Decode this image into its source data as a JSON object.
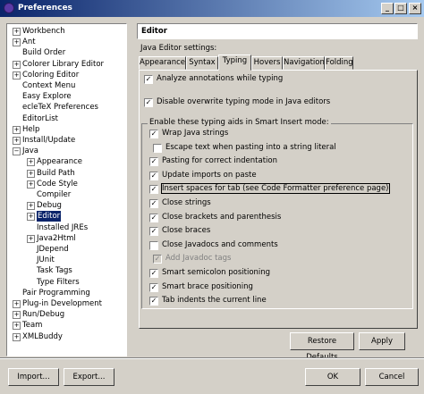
{
  "window": {
    "title": "Preferences",
    "controls": {
      "minimize": "_",
      "maximize": "□",
      "close": "×"
    }
  },
  "tree": {
    "items": [
      {
        "label": "Workbench",
        "toggle": "+"
      },
      {
        "label": "Ant",
        "toggle": "+"
      },
      {
        "label": "Build Order",
        "toggle": ""
      },
      {
        "label": "Colorer Library Editor",
        "toggle": "+"
      },
      {
        "label": "Coloring Editor",
        "toggle": "+"
      },
      {
        "label": "Context Menu",
        "toggle": ""
      },
      {
        "label": "Easy Explore",
        "toggle": ""
      },
      {
        "label": "ecleTeX Preferences",
        "toggle": ""
      },
      {
        "label": "EditorList",
        "toggle": ""
      },
      {
        "label": "Help",
        "toggle": "+"
      },
      {
        "label": "Install/Update",
        "toggle": "+"
      },
      {
        "label": "Java",
        "toggle": "−"
      },
      {
        "label": "Appearance",
        "toggle": "+"
      },
      {
        "label": "Build Path",
        "toggle": "+"
      },
      {
        "label": "Code Style",
        "toggle": "+"
      },
      {
        "label": "Compiler",
        "toggle": ""
      },
      {
        "label": "Debug",
        "toggle": "+"
      },
      {
        "label": "Editor",
        "toggle": "+",
        "selected": true
      },
      {
        "label": "Installed JREs",
        "toggle": ""
      },
      {
        "label": "Java2Html",
        "toggle": "+"
      },
      {
        "label": "JDepend",
        "toggle": ""
      },
      {
        "label": "JUnit",
        "toggle": ""
      },
      {
        "label": "Task Tags",
        "toggle": ""
      },
      {
        "label": "Type Filters",
        "toggle": ""
      },
      {
        "label": "Pair Programming",
        "toggle": ""
      },
      {
        "label": "Plug-in Development",
        "toggle": "+"
      },
      {
        "label": "Run/Debug",
        "toggle": "+"
      },
      {
        "label": "Team",
        "toggle": "+"
      },
      {
        "label": "XMLBuddy",
        "toggle": "+"
      }
    ]
  },
  "page": {
    "title": "Editor",
    "subtitle": "Java Editor settings:"
  },
  "tabs": [
    {
      "label": "Appearance"
    },
    {
      "label": "Syntax"
    },
    {
      "label": "Typing",
      "active": true
    },
    {
      "label": "Hovers"
    },
    {
      "label": "Navigation"
    },
    {
      "label": "Folding"
    }
  ],
  "typing": {
    "top_options": [
      {
        "label": "Analyze annotations while typing",
        "checked": true
      },
      {
        "label": "Disable overwrite typing mode in Java editors",
        "checked": true
      }
    ],
    "group_label": "Enable these typing aids in Smart Insert mode:",
    "group_options": [
      {
        "label": "Wrap Java strings",
        "checked": true
      },
      {
        "label": "Escape text when pasting into a string literal",
        "checked": false,
        "indent": true
      },
      {
        "label": "Pasting for correct indentation",
        "checked": true
      },
      {
        "label": "Update imports on paste",
        "checked": true
      },
      {
        "label": "Insert spaces for tab (see Code Formatter preference page)",
        "checked": true,
        "focused": true
      },
      {
        "label": "Close strings",
        "checked": true
      },
      {
        "label": "Close brackets and parenthesis",
        "checked": true
      },
      {
        "label": "Close braces",
        "checked": true
      },
      {
        "label": "Close Javadocs and comments",
        "checked": false
      },
      {
        "label": "Add Javadoc tags",
        "checked": true,
        "indent": true,
        "disabled": true
      },
      {
        "label": "Smart semicolon positioning",
        "checked": true
      },
      {
        "label": "Smart brace positioning",
        "checked": true
      },
      {
        "label": "Tab indents the current line",
        "checked": true
      }
    ]
  },
  "buttons": {
    "restore_defaults": "Restore Defaults",
    "apply": "Apply",
    "import": "Import...",
    "export": "Export...",
    "ok": "OK",
    "cancel": "Cancel"
  },
  "colors": {
    "selection": "#0a246a",
    "face": "#d4d0c8"
  }
}
